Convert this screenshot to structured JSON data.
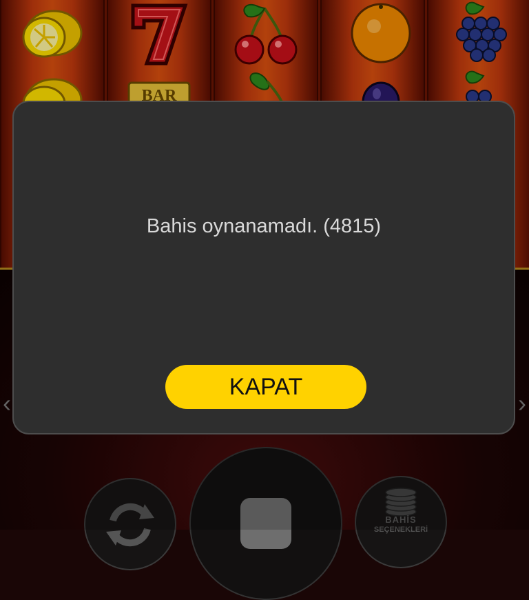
{
  "game": {
    "reels": [
      [
        "lemon",
        "lemon"
      ],
      [
        "seven",
        "bar"
      ],
      [
        "cherry",
        "cherry"
      ],
      [
        "orange",
        "plum"
      ],
      [
        "grapes",
        "grapes"
      ]
    ],
    "bar_symbol_text": "BAR"
  },
  "controls": {
    "autoplay_icon": "refresh-icon",
    "spin_icon": "stop-icon",
    "bet_options_line1": "BAHİS",
    "bet_options_line2": "SEÇENEKLERİ",
    "bet_options_icon": "coin-stack-icon"
  },
  "modal": {
    "message": "Bahis oynanamadı. (4815)",
    "close_label": "KAPAT",
    "close_color": "#ffd200"
  }
}
